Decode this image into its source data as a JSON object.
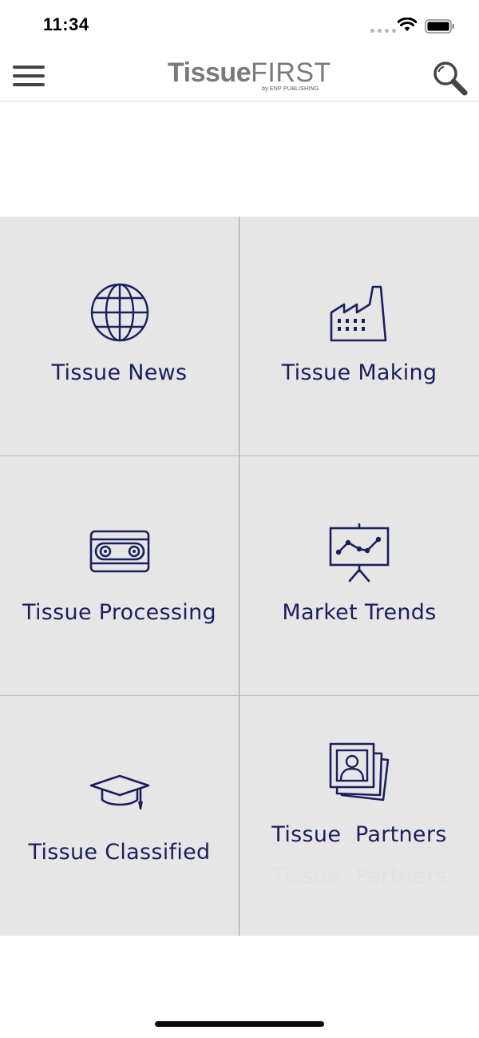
{
  "status_bar": {
    "time": "11:34",
    "icons": [
      "signal-dots-icon",
      "wifi-icon",
      "battery-icon"
    ]
  },
  "header": {
    "menu_icon": "hamburger-menu-icon",
    "logo": {
      "bold": "Tissue",
      "light": "FIRST",
      "sub": "by ENP PUBLISHING"
    },
    "search_icon": "magnifier-icon"
  },
  "tiles": [
    {
      "label": "Tissue News",
      "icon": "globe-icon"
    },
    {
      "label": "Tissue Making",
      "icon": "factory-icon"
    },
    {
      "label": "Tissue Processing",
      "icon": "cassette-icon"
    },
    {
      "label": "Market Trends",
      "icon": "presentation-chart-icon"
    },
    {
      "label": "Tissue Classified",
      "icon": "graduation-cap-icon"
    },
    {
      "label": "Tissue  Partners",
      "icon": "photo-stack-icon",
      "ghost_label": "Tissue  Partners"
    }
  ],
  "colors": {
    "accent": "#1b1f5e",
    "tile_bg": "#e6e6e6",
    "logo_gray": "#7a7a7a"
  }
}
